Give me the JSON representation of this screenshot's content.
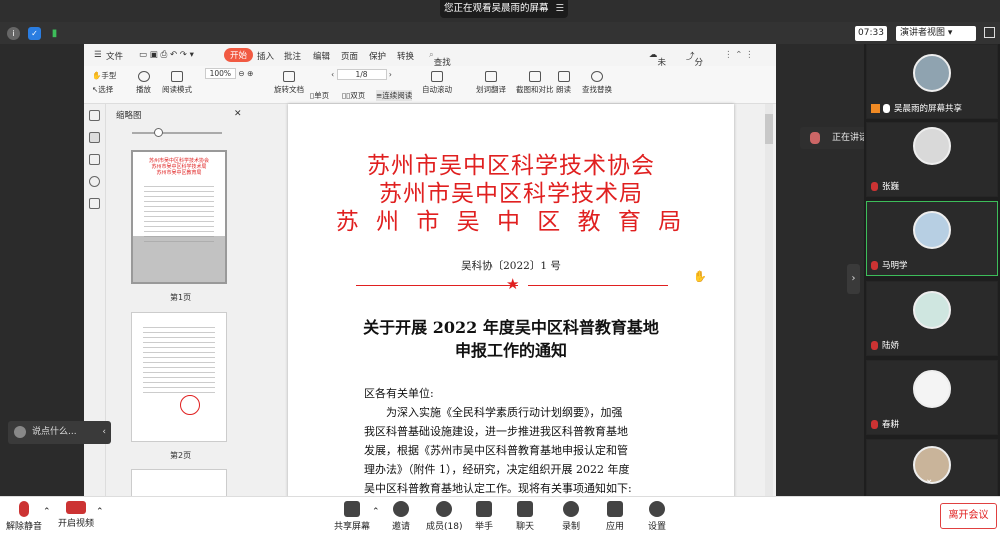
{
  "top": {
    "banner": "您正在观看吴晨雨的屏幕",
    "time": "07:33",
    "view": "演讲者视图"
  },
  "doc": {
    "tabs": [
      "文件",
      "开始",
      "插入",
      "批注",
      "编辑",
      "页面",
      "保护",
      "转换"
    ],
    "search": "查找功能、文档内容",
    "unsynced": "未同步",
    "share": "分享",
    "tools": {
      "hand": "手型",
      "select": "选择",
      "play": "播放",
      "read": "阅读模式",
      "zoom": "100%",
      "rotate": "旋转文档",
      "page": "1/8",
      "single": "单页",
      "double": "双页",
      "continuous": "连续阅读",
      "autoscroll": "自动滚动",
      "translate": "划词翻译",
      "screenshot": "截图和对比",
      "readaloud": "朗读",
      "findreplace": "查找替换"
    },
    "thumb_title": "缩略图",
    "page_labels": [
      "第1页",
      "第2页"
    ],
    "letterhead": [
      "苏州市吴中区科学技术协会",
      "苏州市吴中区科学技术局",
      "苏 州 市 吴 中 区 教 育 局"
    ],
    "docnum": "吴科协〔2022〕1 号",
    "title": [
      "关于开展 2022 年度吴中区科普教育基地",
      "申报工作的通知"
    ],
    "body": [
      "区各有关单位:",
      "　　为深入实施《全民科学素质行动计划纲要》，加强",
      "我区科普基础设施建设，进一步推进我区科普教育基地",
      "发展，根据《苏州市吴中区科普教育基地申报认定和管",
      "理办法》（附件 1），经研究，决定组织开展 2022 年度",
      "吴中区科普教育基地认定工作。现将有关事项通知如下:"
    ]
  },
  "chat": "说点什么...",
  "speaking": "正在讲话: 马明学;",
  "participants": [
    {
      "name": "吴晨雨的屏幕共享"
    },
    {
      "name": "张巍"
    },
    {
      "name": "马明学"
    },
    {
      "name": "陆娇"
    },
    {
      "name": "春耕"
    },
    {
      "name": ""
    }
  ],
  "bottom": {
    "mute": "解除静音",
    "video": "开启视频",
    "share": "共享屏幕",
    "invite": "邀请",
    "members": "成员(18)",
    "raise": "举手",
    "chat": "聊天",
    "record": "录制",
    "apps": "应用",
    "settings": "设置",
    "leave": "离开会议"
  }
}
